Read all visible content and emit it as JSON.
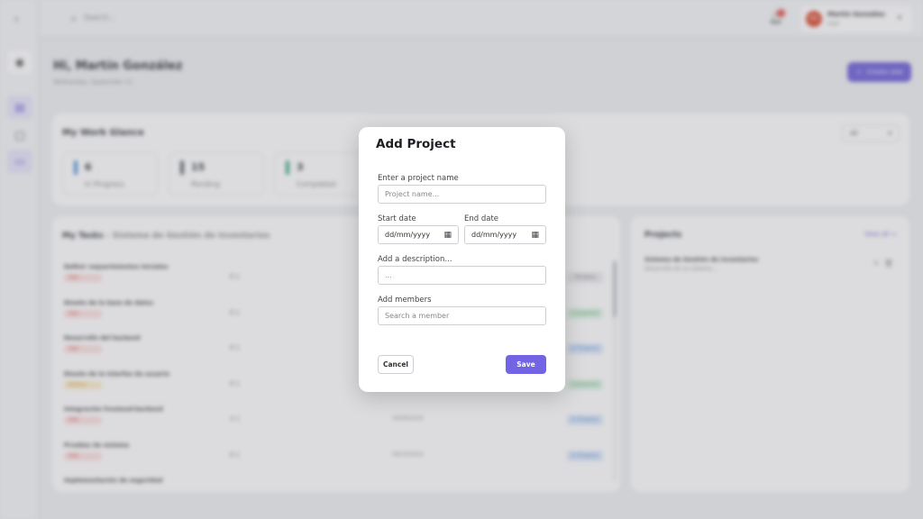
{
  "app": {
    "search_placeholder": "Search...",
    "notification_count": "1",
    "user": {
      "initials": "MG",
      "name": "Martín González",
      "role": "User"
    },
    "greeting": "Hi, Martín González",
    "date": "Wednesday, September 11",
    "create_new_label": "Create new",
    "glance": {
      "title": "My Work Glance",
      "filter_value": "All",
      "stats": [
        {
          "value": "6",
          "label": "In Progress",
          "color": "#4a90d9"
        },
        {
          "value": "15",
          "label": "Pending",
          "color": "#555b63"
        },
        {
          "value": "3",
          "label": "Completed",
          "color": "#3aa57a"
        }
      ]
    },
    "tasks": {
      "title": "My Tasks",
      "project": "Sistema de Gestión de Inventarios",
      "rows": [
        {
          "name": "Definir requerimientos iniciales",
          "priority": "High",
          "meta": "8  1",
          "date": "",
          "status": "Pending"
        },
        {
          "name": "Diseño de la base de datos",
          "priority": "High",
          "meta": "8  1",
          "date": "",
          "status": "Completed"
        },
        {
          "name": "Desarrollo del backend",
          "priority": "High",
          "meta": "8  1",
          "date": "",
          "status": "In Progress"
        },
        {
          "name": "Diseño de la interfaz de usuario",
          "priority": "Medium",
          "meta": "8  1",
          "date": "",
          "status": "Completed"
        },
        {
          "name": "Integración frontend-backend",
          "priority": "High",
          "meta": "4  1",
          "date": "26/09/2024",
          "status": "In Progress"
        },
        {
          "name": "Pruebas de sistema",
          "priority": "High",
          "meta": "8  1",
          "date": "06/10/2024",
          "status": "In Progress"
        },
        {
          "name": "Implementación de seguridad",
          "priority": "",
          "meta": "",
          "date": "",
          "status": ""
        }
      ]
    },
    "projects": {
      "title": "Projects",
      "view_all": "View all →",
      "items": [
        {
          "name": "Sistema de Gestión de Inventarios",
          "description": "Desarrollo de un sistema..."
        }
      ]
    }
  },
  "modal": {
    "title": "Add Project",
    "name_label": "Enter a project name",
    "name_placeholder": "Project name...",
    "start_label": "Start date",
    "start_placeholder": "dd/mm/yyyy",
    "end_label": "End date",
    "end_placeholder": "dd/mm/yyyy",
    "description_label": "Add a description...",
    "description_placeholder": "...",
    "members_label": "Add members",
    "members_placeholder": "Search a member",
    "cancel_label": "Cancel",
    "save_label": "Save"
  },
  "colors": {
    "accent": "#7264e4",
    "priority_high_bg": "#fde0e0",
    "priority_high_fg": "#d64545",
    "priority_medium_bg": "#fdecc8",
    "priority_medium_fg": "#c98a12"
  }
}
